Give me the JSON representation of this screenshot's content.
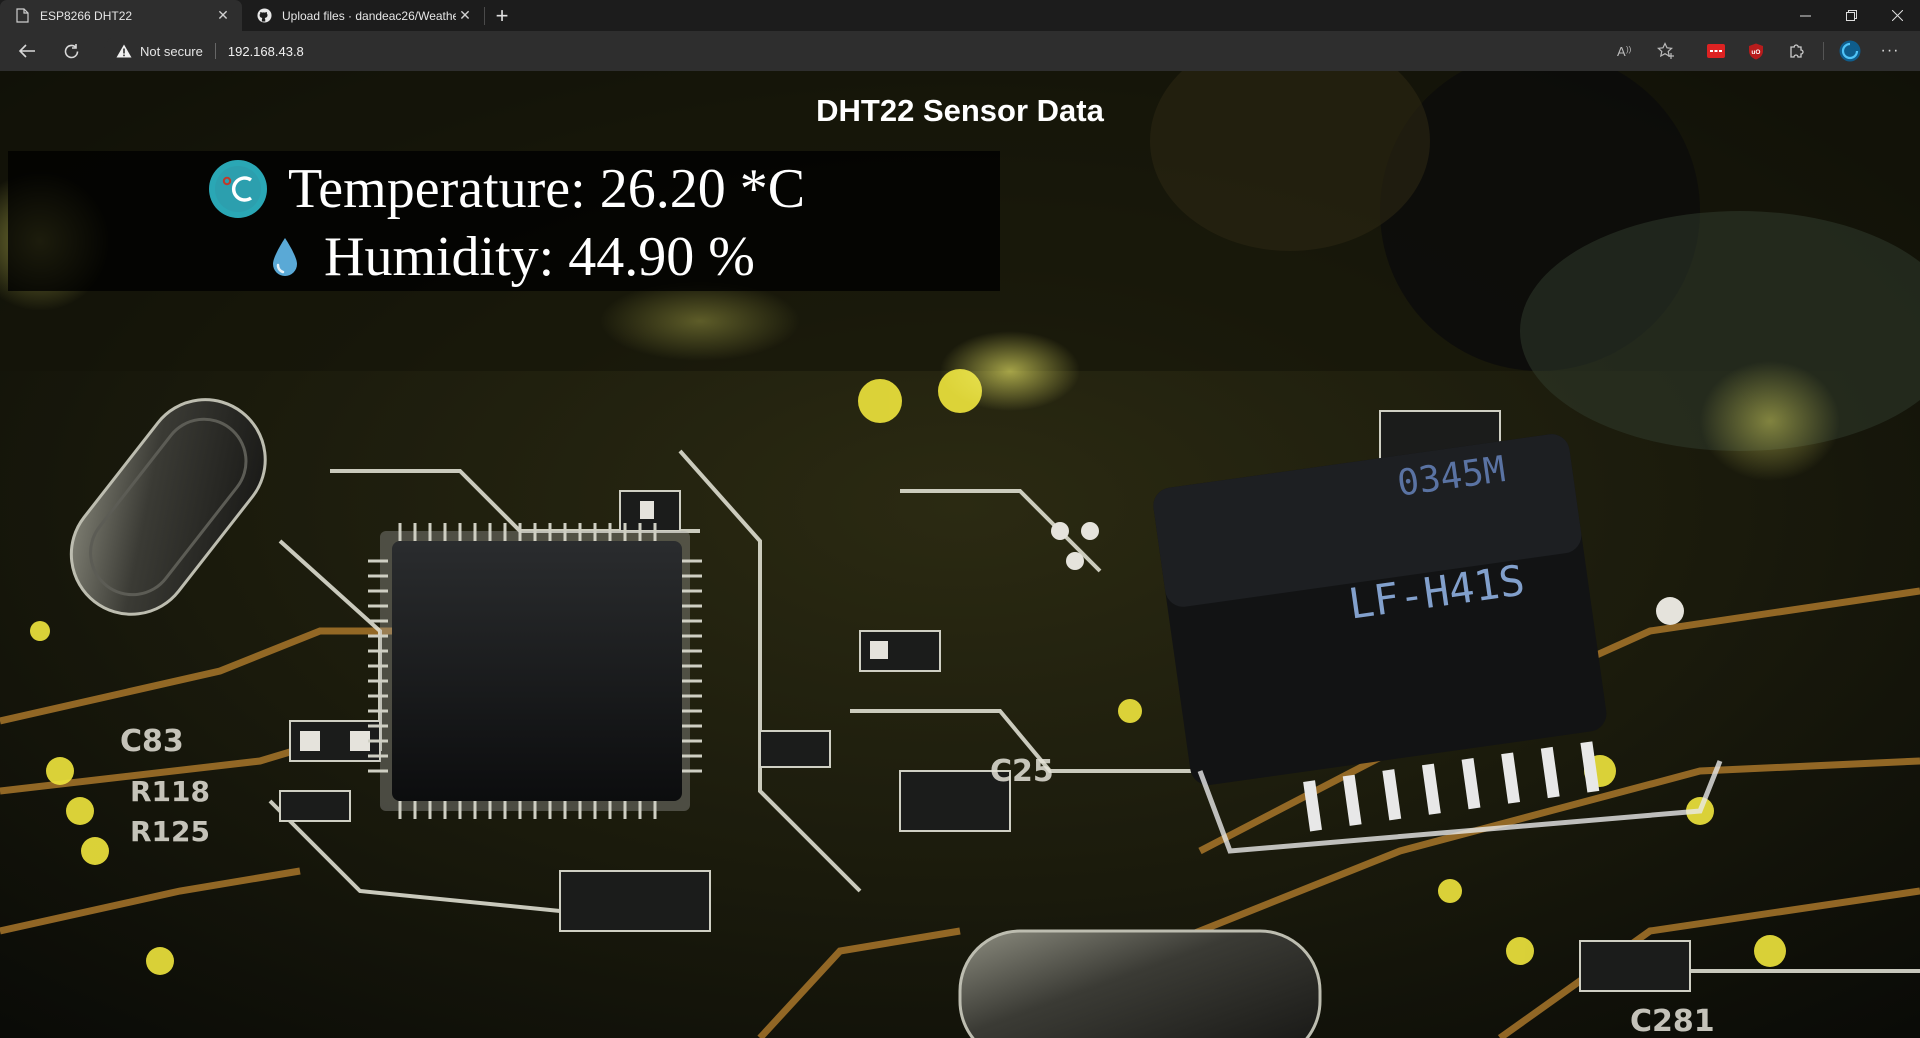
{
  "browser": {
    "tabs": [
      {
        "title": "ESP8266 DHT22",
        "icon": "page-icon",
        "active": true
      },
      {
        "title": "Upload files · dandeac26/Weathe",
        "icon": "github-icon",
        "active": false
      }
    ],
    "new_tab_label": "+",
    "address_bar": {
      "security_label": "Not secure",
      "url": "192.168.43.8"
    },
    "window_controls": [
      "minimize",
      "restore",
      "close"
    ]
  },
  "page": {
    "title": "DHT22 Sensor Data",
    "temperature": {
      "label": "Temperature:",
      "value": "26.20",
      "unit": "*C",
      "icon": "thermometer-celsius-icon",
      "icon_color": "#2aa7b5"
    },
    "humidity": {
      "label": "Humidity:",
      "value": "44.90",
      "unit": "%",
      "icon": "water-drop-icon",
      "icon_color": "#5aa9d6"
    }
  }
}
